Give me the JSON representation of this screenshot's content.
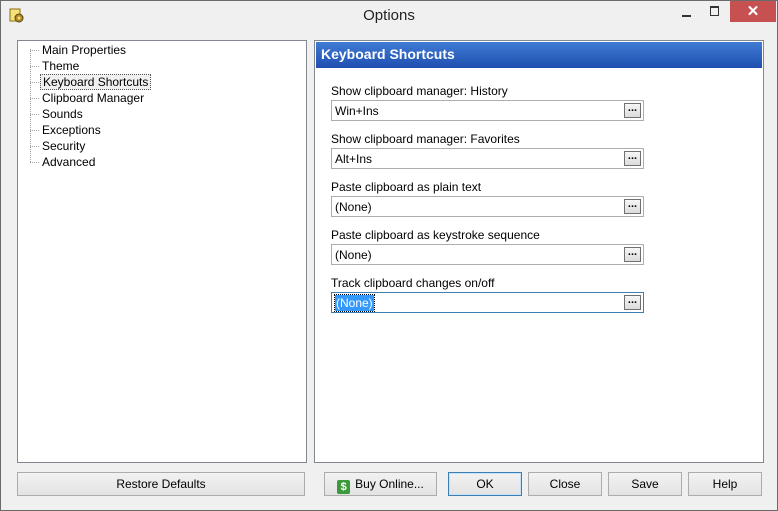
{
  "window": {
    "title": "Options"
  },
  "tree": {
    "items": [
      {
        "label": "Main Properties"
      },
      {
        "label": "Theme"
      },
      {
        "label": "Keyboard Shortcuts",
        "selected": true
      },
      {
        "label": "Clipboard Manager"
      },
      {
        "label": "Sounds"
      },
      {
        "label": "Exceptions"
      },
      {
        "label": "Security"
      },
      {
        "label": "Advanced"
      }
    ]
  },
  "panel": {
    "title": "Keyboard Shortcuts",
    "fields": [
      {
        "label": "Show clipboard manager: History",
        "value": "Win+Ins"
      },
      {
        "label": "Show clipboard manager: Favorites",
        "value": "Alt+Ins"
      },
      {
        "label": "Paste clipboard as plain text",
        "value": "(None)"
      },
      {
        "label": "Paste clipboard as keystroke sequence",
        "value": "(None)"
      },
      {
        "label": "Track clipboard changes on/off",
        "value": "(None)",
        "focused": true
      }
    ],
    "browse_label": "..."
  },
  "buttons": {
    "restore": "Restore Defaults",
    "buy": "Buy Online...",
    "ok": "OK",
    "close": "Close",
    "save": "Save",
    "help": "Help"
  },
  "icons": {
    "app": "gear-document-icon",
    "buy": "dollar-icon",
    "dollar_glyph": "$",
    "close_glyph": "✕"
  },
  "colors": {
    "header_start": "#3f7bd3",
    "header_end": "#1f4fb0",
    "selection": "#3399ff",
    "close_button": "#c75050"
  }
}
